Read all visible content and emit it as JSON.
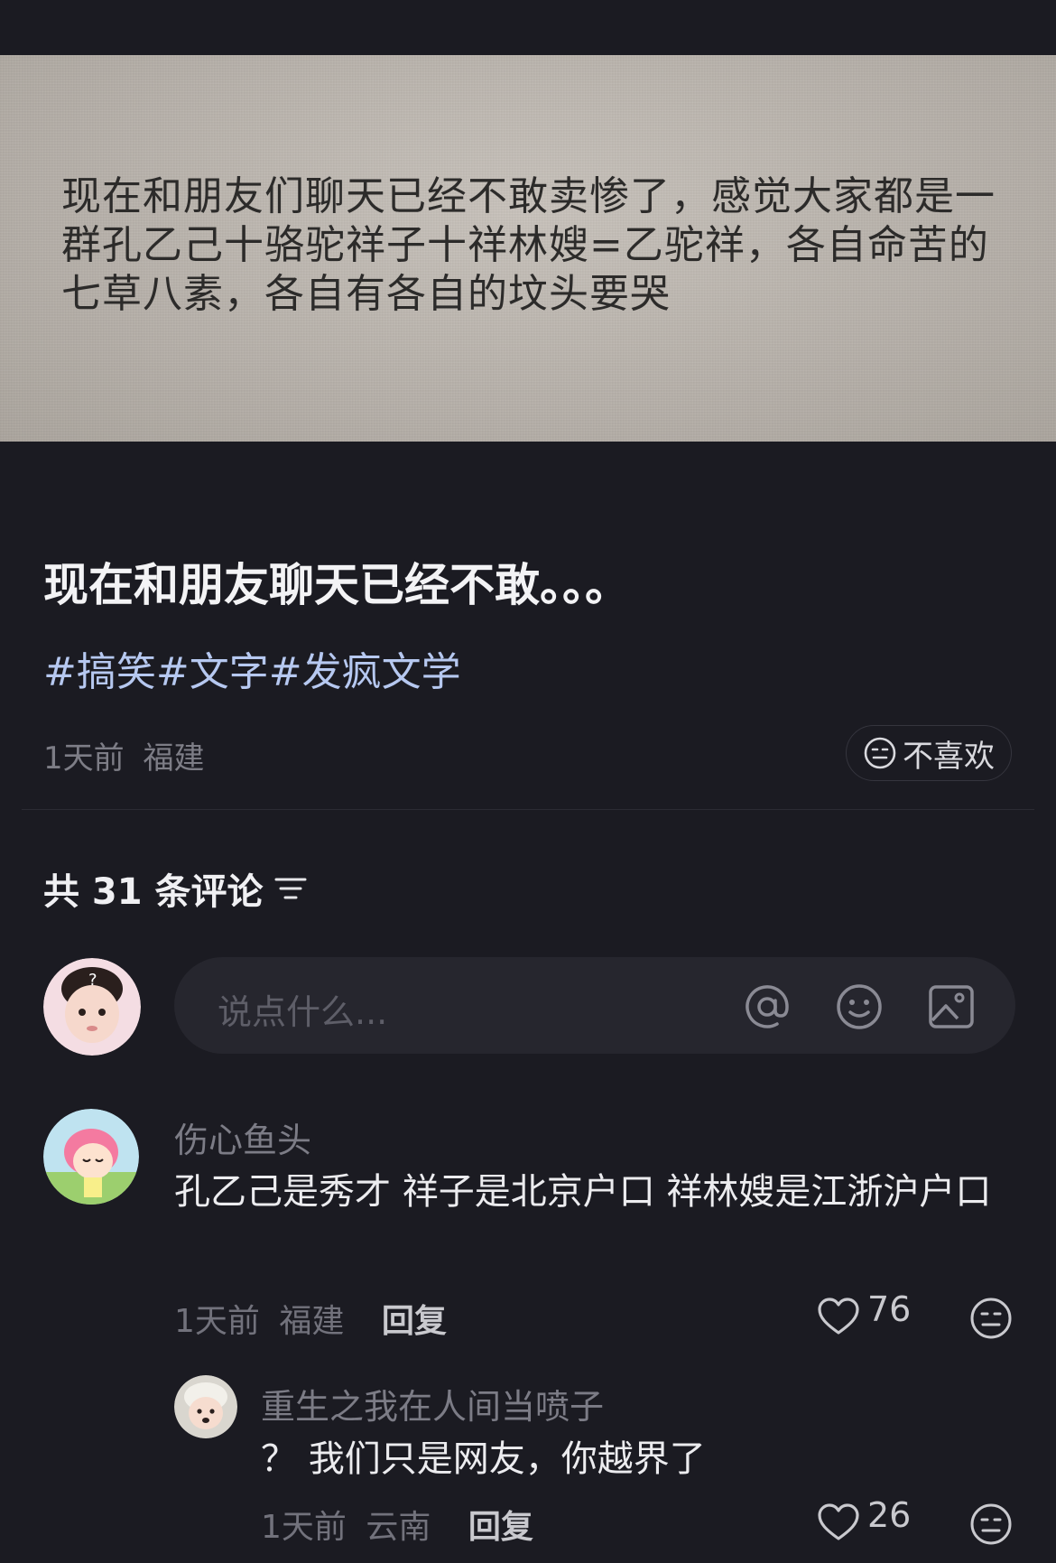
{
  "post": {
    "image_text": "现在和朋友们聊天已经不敢卖惨了，感觉大家都是一群孔乙己十骆驼祥子十祥林嫂=乙驼祥，各自命苦的七草八素，各自有各自的坟头要哭",
    "title": "现在和朋友聊天已经不敢。。。",
    "tags": [
      "#搞笑",
      "#文字",
      "#发疯文学"
    ],
    "time": "1天前",
    "location": "福建",
    "dislike_label": "不喜欢"
  },
  "comments_section": {
    "count_text": "共 31 条评论",
    "input_placeholder": "说点什么..."
  },
  "comments": [
    {
      "name": "伤心鱼头",
      "text": "孔乙己是秀才 祥子是北京户口 祥林嫂是江浙沪户口",
      "time": "1天前",
      "location": "福建",
      "reply_label": "回复",
      "likes": "76"
    },
    {
      "name": "重生之我在人间当喷子",
      "text": "？ 我们只是网友，你越界了",
      "time": "1天前",
      "location": "云南",
      "reply_label": "回复",
      "likes": "26"
    }
  ],
  "icons": {
    "dislike": "neutral-face-icon",
    "filter": "sort-lines-icon",
    "mention": "at-sign-icon",
    "emoji": "smiley-face-icon",
    "image": "image-icon",
    "like": "heart-icon"
  },
  "colors": {
    "background": "#1b1b22",
    "tag": "#b6c8f0",
    "input_bg": "#26262e"
  }
}
